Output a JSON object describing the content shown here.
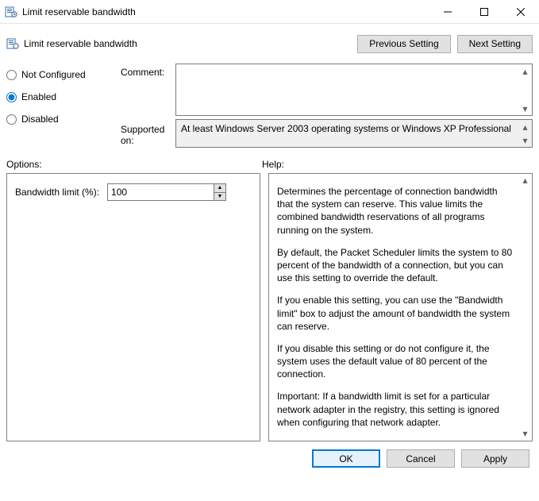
{
  "window": {
    "title": "Limit reservable bandwidth"
  },
  "header": {
    "policy_name": "Limit reservable bandwidth",
    "prev_btn": "Previous Setting",
    "next_btn": "Next Setting"
  },
  "state": {
    "not_configured": "Not Configured",
    "enabled": "Enabled",
    "disabled": "Disabled",
    "selected": "enabled"
  },
  "labels": {
    "comment": "Comment:",
    "supported_on": "Supported on:",
    "options": "Options:",
    "help": "Help:"
  },
  "comment_value": "",
  "supported_on_text": "At least Windows Server 2003 operating systems or Windows XP Professional",
  "options": {
    "bandwidth_label": "Bandwidth limit (%):",
    "bandwidth_value": "100"
  },
  "help_text": {
    "p1": "Determines the percentage of connection bandwidth that the system can reserve. This value limits the combined bandwidth reservations of all programs running on the system.",
    "p2": "By default, the Packet Scheduler limits the system to 80 percent of the bandwidth of a connection, but you can use this setting to override the default.",
    "p3": "If you enable this setting, you can use the \"Bandwidth limit\" box to adjust the amount of bandwidth the system can reserve.",
    "p4": "If you disable this setting or do not configure it, the system uses the default value of 80 percent of the connection.",
    "p5": "Important: If a bandwidth limit is set for a particular network adapter in the registry, this setting is ignored when configuring that network adapter."
  },
  "buttons": {
    "ok": "OK",
    "cancel": "Cancel",
    "apply": "Apply"
  }
}
